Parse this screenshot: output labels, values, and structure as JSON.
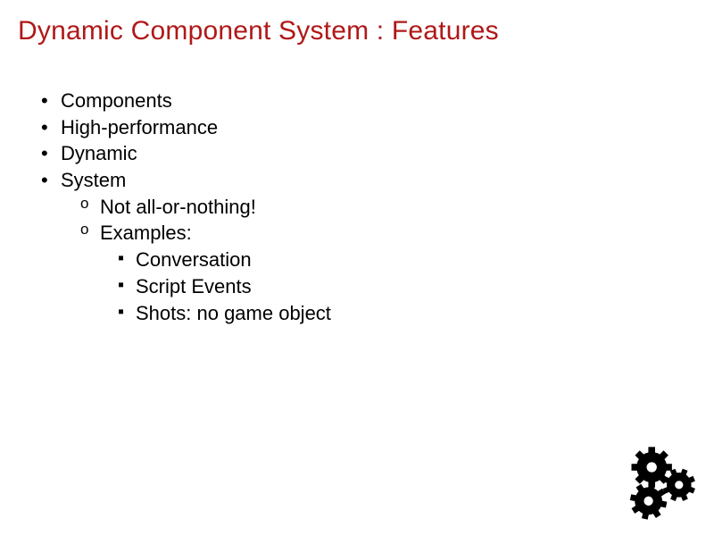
{
  "title": "Dynamic Component System : Features",
  "bullets": {
    "l1": [
      "Components",
      "High-performance",
      "Dynamic",
      "System"
    ],
    "l2": [
      "Not all-or-nothing!",
      "Examples:"
    ],
    "l3": [
      "Conversation",
      "Script Events",
      "Shots: no game object"
    ]
  }
}
